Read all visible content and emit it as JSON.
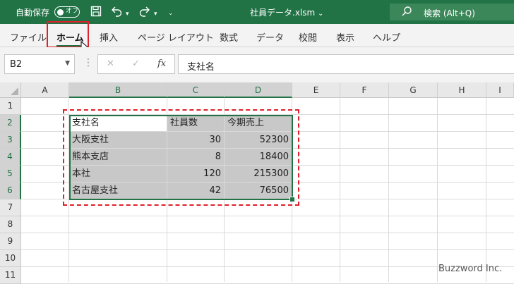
{
  "titlebar": {
    "autosave_label": "自動保存",
    "autosave_toggle": "オフ",
    "filename": "社員データ.xlsm",
    "filename_caret": "⌄",
    "search_placeholder": "検索 (Alt+Q)",
    "icons": [
      "save-icon",
      "undo-icon",
      "undo-dropdown-icon",
      "redo-icon",
      "redo-dropdown-icon",
      "customize-qat-icon",
      "search-icon"
    ]
  },
  "ribbon": {
    "tabs": [
      {
        "label": "ファイル"
      },
      {
        "label": "ホーム",
        "active": true
      },
      {
        "label": "挿入"
      },
      {
        "label": "ページ レイアウト"
      },
      {
        "label": "数式"
      },
      {
        "label": "データ"
      },
      {
        "label": "校閲"
      },
      {
        "label": "表示"
      },
      {
        "label": "ヘルプ"
      }
    ]
  },
  "formula_bar": {
    "name_box": "B2",
    "formula": "支社名",
    "cancel_symbol": "✕",
    "enter_symbol": "✓",
    "fx_symbol": "fx"
  },
  "sheet": {
    "columns": [
      "A",
      "B",
      "C",
      "D",
      "E",
      "F",
      "G",
      "H",
      "I"
    ],
    "rows": [
      "1",
      "2",
      "3",
      "4",
      "5",
      "6",
      "7",
      "8",
      "9",
      "10",
      "11"
    ],
    "cells": {
      "B2": "支社名",
      "C2": "社員数",
      "D2": "今期売上",
      "B3": "大阪支社",
      "C3": "30",
      "D3": "52300",
      "B4": "熊本支店",
      "C4": "8",
      "D4": "18400",
      "B5": "本社",
      "C5": "120",
      "D5": "215300",
      "B6": "名古屋支社",
      "C6": "42",
      "D6": "76500"
    },
    "selected_range": "B2:D6",
    "selected_columns": [
      "B",
      "C",
      "D"
    ],
    "selected_rows": [
      "2",
      "3",
      "4",
      "5",
      "6"
    ]
  },
  "watermark": "Buzzword Inc.",
  "colors": {
    "accent": "#217346",
    "highlight": "#e0202a",
    "selection_fill": "#c8c8c8"
  }
}
